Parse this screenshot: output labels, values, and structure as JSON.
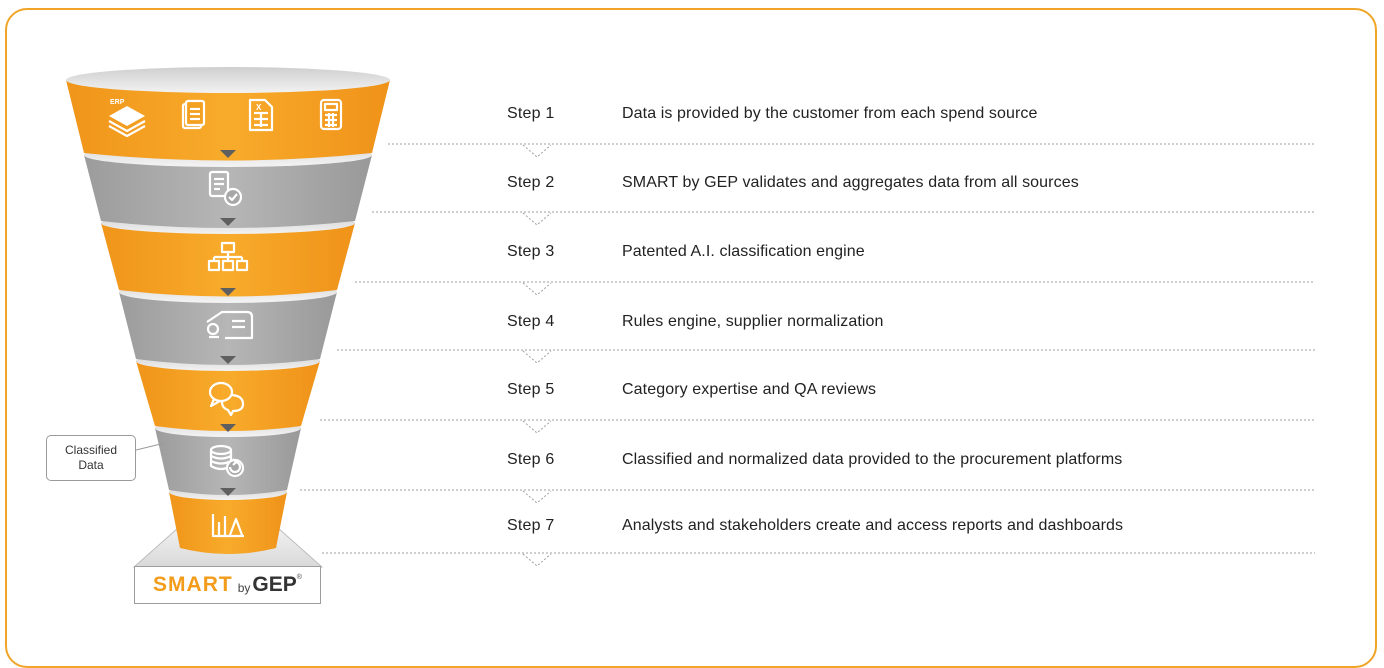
{
  "steps": [
    {
      "label": "Step 1",
      "description": "Data is provided by the customer from each spend source"
    },
    {
      "label": "Step 2",
      "description": "SMART by GEP validates and aggregates data from all sources"
    },
    {
      "label": "Step 3",
      "description": "Patented A.I. classification engine"
    },
    {
      "label": "Step 4",
      "description": "Rules engine, supplier normalization"
    },
    {
      "label": "Step 5",
      "description": "Category expertise and QA reviews"
    },
    {
      "label": "Step 6",
      "description": "Classified and normalized data provided to the procurement platforms"
    },
    {
      "label": "Step 7",
      "description": "Analysts and stakeholders create and access reports and dashboards"
    }
  ],
  "callout": {
    "line1": "Classified",
    "line2": "Data"
  },
  "logo": {
    "smart": "SMART",
    "by": "by",
    "gep": "GEP",
    "registered": "®"
  },
  "icons": {
    "erp_tag": "ERP",
    "excel_tag": "X",
    "tier1": [
      "erp-layers-icon",
      "document-icon",
      "spreadsheet-icon",
      "calculator-icon"
    ],
    "tiers": [
      "validate-document-icon",
      "hierarchy-icon",
      "rules-icon",
      "review-chat-icon",
      "database-refresh-icon",
      "analytics-chart-icon"
    ]
  },
  "colors": {
    "orange": "#f4a020",
    "gray": "#a7a7a7",
    "frame": "#f0a428",
    "divider": "#9f9f9f"
  }
}
